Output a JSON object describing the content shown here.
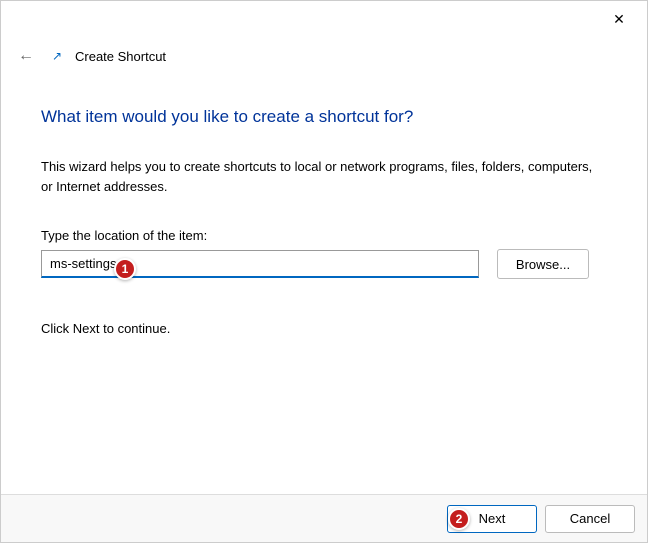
{
  "titlebar": {
    "close_glyph": "✕"
  },
  "header": {
    "back_glyph": "←",
    "icon_glyph": "↗",
    "title": "Create Shortcut"
  },
  "content": {
    "heading": "What item would you like to create a shortcut for?",
    "description": "This wizard helps you to create shortcuts to local or network programs, files, folders, computers, or Internet addresses.",
    "field_label": "Type the location of the item:",
    "location_value": "ms-settings:",
    "browse_label": "Browse...",
    "continue_text": "Click Next to continue."
  },
  "footer": {
    "next_label": "Next",
    "cancel_label": "Cancel"
  },
  "annotations": {
    "badge1": "1",
    "badge2": "2"
  }
}
